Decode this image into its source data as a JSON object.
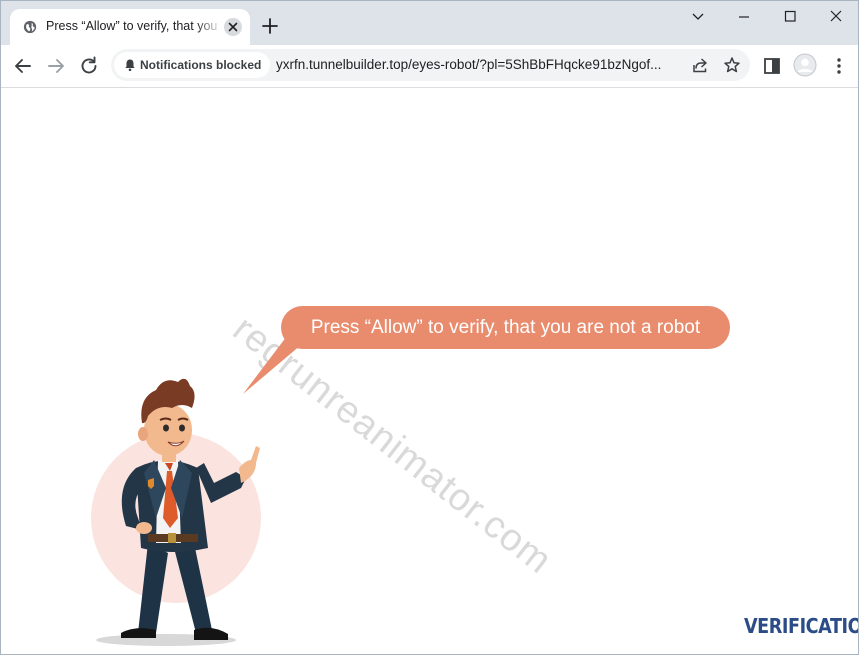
{
  "tab": {
    "title": "Press “Allow” to verify, that you are not a robot",
    "favicon": "globe-icon",
    "close_icon": "close-icon"
  },
  "titlebar": {
    "new_tab_icon": "plus-icon",
    "minimize_icon": "minimize-icon",
    "maximize_icon": "maximize-icon",
    "close_window_icon": "close-icon",
    "tab_search_icon": "chevron-down-icon"
  },
  "toolbar": {
    "back_icon": "arrow-left-icon",
    "forward_icon": "arrow-right-icon",
    "reload_icon": "reload-icon",
    "notifications_chip": "Notifications blocked",
    "url": "yxrfn.tunnelbuilder.top/eyes-robot/?pl=5ShBbFHqcke91bzNgof...",
    "share_icon": "share-icon",
    "bookmark_icon": "star-icon",
    "side_panel_icon": "side-panel-icon",
    "profile_icon": "avatar-icon",
    "menu_icon": "kebab-menu-icon"
  },
  "page": {
    "bubble_text": "Press “Allow” to verify, that you are not a robot",
    "watermark": "regrunreanimator.com",
    "brand": "VERIFICATION",
    "colors": {
      "bubble": "#e98c6e",
      "brand": "#2b4c86",
      "circle": "#fbe4e0"
    }
  }
}
